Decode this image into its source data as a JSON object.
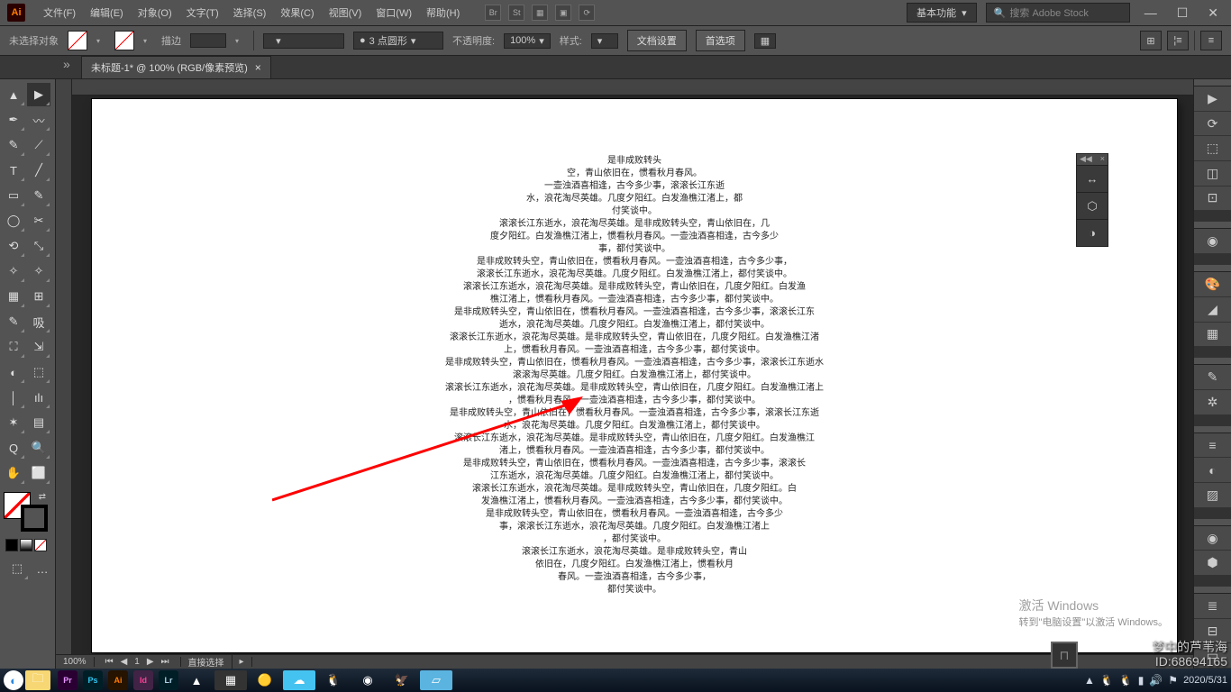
{
  "menubar": {
    "items": [
      "文件(F)",
      "编辑(E)",
      "对象(O)",
      "文字(T)",
      "选择(S)",
      "效果(C)",
      "视图(V)",
      "窗口(W)",
      "帮助(H)"
    ],
    "center_icons": [
      "Br",
      "St",
      "▦",
      "▣",
      "⟳"
    ],
    "workspace_label": "基本功能",
    "search_placeholder": "搜索 Adobe Stock"
  },
  "controlbar": {
    "selection_label": "未选择对象",
    "stroke_label": "描边",
    "stroke_width": "",
    "brush_label": "3 点圆形",
    "opacity_label": "不透明度:",
    "opacity_value": "100%",
    "style_label": "样式:",
    "doc_setup": "文档设置",
    "prefs": "首选项"
  },
  "tabs": {
    "title": "未标题-1* @ 100% (RGB/像素预览)"
  },
  "tools": [
    "▲",
    "▶",
    "✒",
    "〰",
    "✎",
    "⟋",
    "T",
    "╱",
    "▭",
    "✎",
    "◯",
    "✂",
    "⟲",
    "⤡",
    "✧",
    "✧",
    "▦",
    "⊞",
    "✎",
    "吸",
    "⛶",
    "⇲",
    "◐",
    "⬚",
    "│",
    "ılı",
    "✶",
    "▤",
    "Q",
    "🔍",
    "✋",
    "⬜"
  ],
  "canvas": {
    "lines": [
      "是非成败转头",
      "空，青山依旧在，惯看秋月春风。",
      "一壶浊酒喜相逢，古今多少事，滚滚长江东逝",
      "水，浪花淘尽英雄。几度夕阳红。白发渔樵江渚上，都",
      "付笑谈中。",
      "滚滚长江东逝水，浪花淘尽英雄。是非成败转头空，青山依旧在，几",
      "度夕阳红。白发渔樵江渚上，惯看秋月春风。一壶浊酒喜相逢，古今多少",
      "事，都付笑谈中。",
      "是非成败转头空，青山依旧在，惯看秋月春风。一壶浊酒喜相逢，古今多少事，",
      "滚滚长江东逝水，浪花淘尽英雄。几度夕阳红。白发渔樵江渚上，都付笑谈中。",
      "滚滚长江东逝水，浪花淘尽英雄。是非成败转头空，青山依旧在，几度夕阳红。白发渔",
      "樵江渚上，惯看秋月春风。一壶浊酒喜相逢，古今多少事，都付笑谈中。",
      "是非成败转头空，青山依旧在，惯看秋月春风。一壶浊酒喜相逢，古今多少事，滚滚长江东",
      "逝水，浪花淘尽英雄。几度夕阳红。白发渔樵江渚上，都付笑谈中。",
      "滚滚长江东逝水，浪花淘尽英雄。是非成败转头空，青山依旧在，几度夕阳红。白发渔樵江渚",
      "上，惯看秋月春风。一壶浊酒喜相逢，古今多少事，都付笑谈中。",
      "是非成败转头空，青山依旧在，惯看秋月春风。一壶浊酒喜相逢，古今多少事，滚滚长江东逝水",
      "滚滚淘尽英雄。几度夕阳红。白发渔樵江渚上，都付笑谈中。",
      "滚滚长江东逝水，浪花淘尽英雄。是非成败转头空，青山依旧在，几度夕阳红。白发渔樵江渚上",
      "，惯看秋月春风。一壶浊酒喜相逢，古今多少事，都付笑谈中。",
      "是非成败转头空，青山依旧在，惯看秋月春风。一壶浊酒喜相逢，古今多少事，滚滚长江东逝",
      "水，浪花淘尽英雄。几度夕阳红。白发渔樵江渚上，都付笑谈中。",
      "滚滚长江东逝水，浪花淘尽英雄。是非成败转头空，青山依旧在，几度夕阳红。白发渔樵江",
      "渚上，惯看秋月春风。一壶浊酒喜相逢，古今多少事，都付笑谈中。",
      "是非成败转头空，青山依旧在，惯看秋月春风。一壶浊酒喜相逢，古今多少事，滚滚长",
      "江东逝水，浪花淘尽英雄。几度夕阳红。白发渔樵江渚上，都付笑谈中。",
      "滚滚长江东逝水，浪花淘尽英雄。是非成败转头空，青山依旧在，几度夕阳红。白",
      "发渔樵江渚上，惯看秋月春风。一壶浊酒喜相逢，古今多少事，都付笑谈中。",
      "是非成败转头空，青山依旧在，惯看秋月春风。一壶浊酒喜相逢，古今多少",
      "事，滚滚长江东逝水，浪花淘尽英雄。几度夕阳红。白发渔樵江渚上",
      "，都付笑谈中。",
      "滚滚长江东逝水，浪花淘尽英雄。是非成败转头空，青山",
      "依旧在，几度夕阳红。白发渔樵江渚上，惯看秋月",
      "春风。一壶浊酒喜相逢，古今多少事，",
      "都付笑谈中。"
    ]
  },
  "status": {
    "zoom": "100%",
    "page": "1",
    "mode": "直接选择"
  },
  "watermark": {
    "title": "激活 Windows",
    "sub": "转到\"电脑设置\"以激活 Windows。",
    "corner1": "梦中的芦苇海",
    "corner2": "ID:68694165"
  },
  "taskbar": {
    "adobe": [
      {
        "txt": "Pr",
        "bg": "#2a0033",
        "fg": "#e794ff"
      },
      {
        "txt": "Ps",
        "bg": "#001e26",
        "fg": "#31c5f0"
      },
      {
        "txt": "Ai",
        "bg": "#261300",
        "fg": "#ff7c00"
      },
      {
        "txt": "Id",
        "bg": "#412346",
        "fg": "#ff3f94"
      },
      {
        "txt": "Lr",
        "bg": "#001e26",
        "fg": "#aed4e6"
      }
    ],
    "time": "2020/5/31"
  },
  "float_panel": [
    "↔",
    "⬡",
    "◑"
  ]
}
